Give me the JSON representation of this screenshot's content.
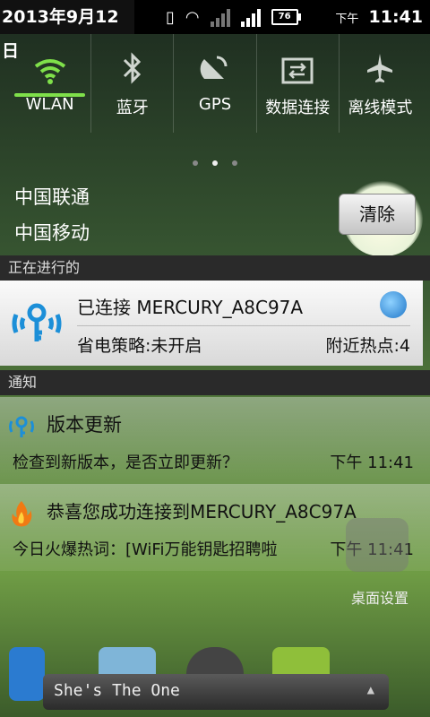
{
  "status_bar": {
    "date": "2013年9月12日",
    "ampm": "下午",
    "time": "11:41",
    "battery": "76"
  },
  "quick_toggles": [
    {
      "label": "WLAN",
      "icon": "wifi-icon",
      "active": true
    },
    {
      "label": "蓝牙",
      "icon": "bluetooth-icon",
      "active": false
    },
    {
      "label": "GPS",
      "icon": "gps-icon",
      "active": false
    },
    {
      "label": "数据连接",
      "icon": "data-connection-icon",
      "active": false
    },
    {
      "label": "离线模式",
      "icon": "airplane-icon",
      "active": false
    }
  ],
  "carriers": [
    "中国联通",
    "中国移动"
  ],
  "clear_button": "清除",
  "sections": {
    "ongoing": "正在进行的",
    "notifications": "通知"
  },
  "ongoing_item": {
    "title": "已连接 MERCURY_A8C97A",
    "power_policy": "省电策略:未开启",
    "nearby": "附近热点:4"
  },
  "notifications": [
    {
      "title": "版本更新",
      "body": "检查到新版本，是否立即更新？",
      "time": "下午 11:41",
      "icon": "wifi-key-icon"
    },
    {
      "title": "恭喜您成功连接到MERCURY_A8C97A",
      "body": "今日火爆热词：[WiFi万能钥匙招聘啦",
      "time": "下午 11:41",
      "icon": "flame-icon"
    }
  ],
  "desktop_settings": "桌面设置",
  "music": {
    "song": "She's The One"
  },
  "colors": {
    "accent_green": "#7fe04a",
    "link_blue": "#1f76c8"
  }
}
